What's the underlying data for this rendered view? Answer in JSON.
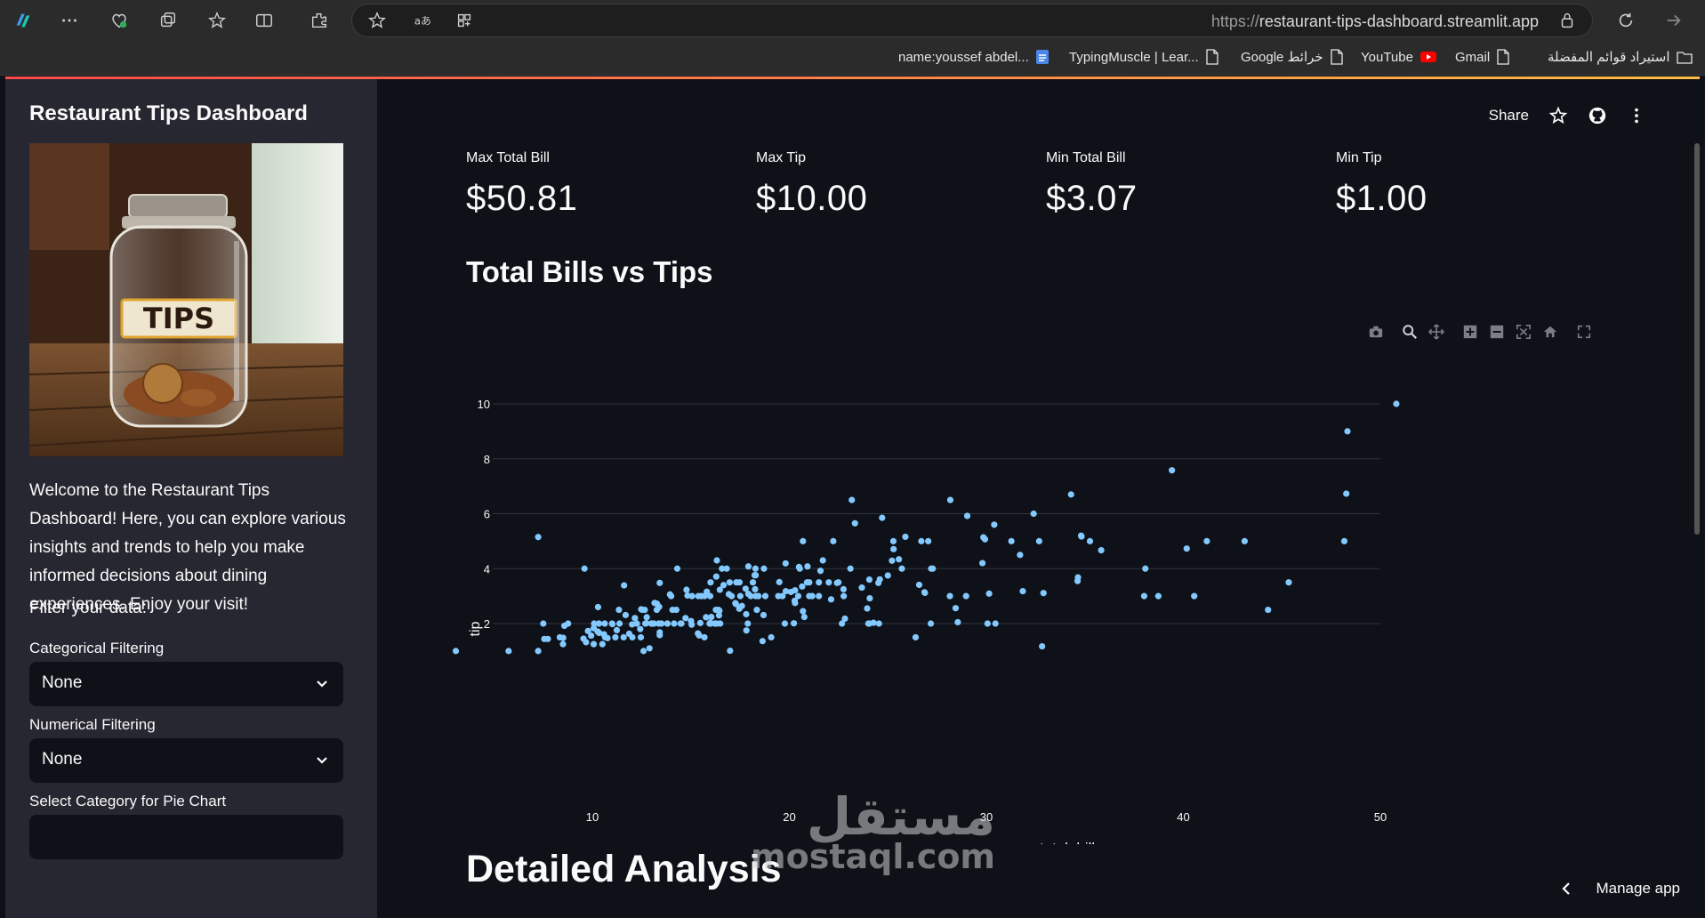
{
  "browser": {
    "url_protocol": "https://",
    "url_host": "restaurant-tips-dashboard.streamlit.app",
    "bookmarks": [
      "name:youssef abdel...",
      "TypingMuscle | Lear...",
      "Google خرائط",
      "YouTube",
      "Gmail",
      "استيراد قوائم المفضلة"
    ]
  },
  "sidebar": {
    "title": "Restaurant Tips Dashboard",
    "jar_label": "TIPS",
    "welcome": "Welcome to the Restaurant Tips Dashboard! Here, you can explore various insights and trends to help you make informed decisions about dining experiences. Enjoy your visit!",
    "filter_heading": "Filter your data:",
    "categorical_label": "Categorical Filtering",
    "categorical_value": "None",
    "numerical_label": "Numerical Filtering",
    "numerical_value": "None",
    "pie_label": "Select Category for Pie Chart"
  },
  "header": {
    "share_label": "Share"
  },
  "metrics": [
    {
      "label": "Max Total Bill",
      "value": "$50.81"
    },
    {
      "label": "Max Tip",
      "value": "$10.00"
    },
    {
      "label": "Min Total Bill",
      "value": "$3.07"
    },
    {
      "label": "Min Tip",
      "value": "$1.00"
    }
  ],
  "section_title": "Total Bills vs Tips",
  "section_title_2": "Detailed Analysis",
  "manage_label": "Manage app",
  "watermark": {
    "arabic": "مستقل",
    "latin": "mostaql.com"
  },
  "colors": {
    "marker": "#83c9ff",
    "grid": "#31333f",
    "accent": "#ff4b4b"
  },
  "chart_data": {
    "type": "scatter",
    "title": "",
    "xlabel": "total_bill",
    "ylabel": "tip",
    "xlim": [
      2.5,
      53.5
    ],
    "ylim": [
      0.7,
      10.4
    ],
    "xticks": [
      10,
      20,
      30,
      40,
      50
    ],
    "yticks": [
      2,
      4,
      6,
      8,
      10
    ],
    "grid": true,
    "points": [
      [
        16.99,
        1.01
      ],
      [
        10.34,
        1.66
      ],
      [
        21.01,
        3.5
      ],
      [
        23.68,
        3.31
      ],
      [
        24.59,
        3.61
      ],
      [
        25.29,
        4.71
      ],
      [
        8.77,
        2.0
      ],
      [
        26.88,
        3.12
      ],
      [
        15.04,
        1.96
      ],
      [
        14.78,
        3.23
      ],
      [
        10.27,
        1.71
      ],
      [
        35.26,
        5.0
      ],
      [
        15.42,
        1.57
      ],
      [
        18.43,
        3.0
      ],
      [
        14.83,
        3.02
      ],
      [
        21.58,
        3.92
      ],
      [
        10.33,
        1.67
      ],
      [
        16.29,
        3.71
      ],
      [
        16.97,
        3.5
      ],
      [
        20.65,
        3.35
      ],
      [
        17.92,
        4.08
      ],
      [
        20.29,
        2.75
      ],
      [
        15.77,
        2.23
      ],
      [
        39.42,
        7.58
      ],
      [
        19.82,
        3.18
      ],
      [
        17.81,
        2.34
      ],
      [
        13.37,
        2.0
      ],
      [
        12.69,
        2.0
      ],
      [
        21.7,
        4.3
      ],
      [
        19.65,
        3.0
      ],
      [
        9.55,
        1.45
      ],
      [
        18.35,
        2.5
      ],
      [
        15.06,
        3.0
      ],
      [
        20.69,
        2.45
      ],
      [
        17.78,
        3.27
      ],
      [
        24.06,
        3.6
      ],
      [
        16.31,
        2.0
      ],
      [
        16.93,
        3.07
      ],
      [
        18.69,
        2.31
      ],
      [
        31.27,
        5.0
      ],
      [
        16.04,
        2.24
      ],
      [
        17.46,
        2.54
      ],
      [
        13.94,
        3.06
      ],
      [
        9.68,
        1.32
      ],
      [
        30.4,
        5.6
      ],
      [
        18.29,
        3.0
      ],
      [
        22.23,
        5.0
      ],
      [
        32.4,
        6.0
      ],
      [
        28.55,
        2.05
      ],
      [
        18.04,
        3.0
      ],
      [
        12.54,
        2.5
      ],
      [
        10.29,
        2.6
      ],
      [
        34.81,
        5.2
      ],
      [
        9.94,
        1.56
      ],
      [
        25.56,
        4.34
      ],
      [
        19.49,
        3.51
      ],
      [
        38.01,
        3.0
      ],
      [
        26.41,
        1.5
      ],
      [
        11.24,
        1.76
      ],
      [
        48.27,
        6.73
      ],
      [
        20.29,
        3.21
      ],
      [
        13.81,
        2.0
      ],
      [
        11.02,
        1.98
      ],
      [
        18.29,
        3.76
      ],
      [
        17.59,
        2.64
      ],
      [
        20.08,
        3.15
      ],
      [
        16.45,
        2.47
      ],
      [
        3.07,
        1.0
      ],
      [
        20.23,
        2.01
      ],
      [
        15.01,
        2.09
      ],
      [
        12.02,
        1.97
      ],
      [
        17.07,
        3.0
      ],
      [
        26.86,
        3.14
      ],
      [
        25.28,
        5.0
      ],
      [
        14.73,
        2.2
      ],
      [
        10.51,
        1.25
      ],
      [
        17.92,
        3.08
      ],
      [
        27.2,
        4.0
      ],
      [
        22.76,
        3.0
      ],
      [
        17.29,
        2.71
      ],
      [
        19.44,
        3.0
      ],
      [
        16.66,
        3.4
      ],
      [
        10.07,
        1.83
      ],
      [
        32.68,
        5.0
      ],
      [
        15.98,
        2.03
      ],
      [
        34.83,
        5.17
      ],
      [
        13.03,
        2.0
      ],
      [
        18.28,
        4.0
      ],
      [
        24.71,
        5.85
      ],
      [
        21.16,
        3.0
      ],
      [
        28.97,
        3.0
      ],
      [
        22.49,
        3.5
      ],
      [
        5.75,
        1.0
      ],
      [
        16.32,
        4.3
      ],
      [
        22.75,
        3.25
      ],
      [
        40.17,
        4.73
      ],
      [
        27.28,
        4.0
      ],
      [
        12.03,
        1.5
      ],
      [
        21.01,
        3.0
      ],
      [
        12.46,
        1.5
      ],
      [
        11.35,
        2.5
      ],
      [
        15.38,
        3.0
      ],
      [
        44.3,
        2.5
      ],
      [
        22.42,
        3.48
      ],
      [
        20.92,
        4.08
      ],
      [
        15.36,
        1.64
      ],
      [
        20.49,
        4.06
      ],
      [
        25.21,
        4.29
      ],
      [
        18.24,
        3.76
      ],
      [
        14.31,
        4.0
      ],
      [
        14.0,
        3.0
      ],
      [
        7.25,
        1.0
      ],
      [
        38.07,
        4.0
      ],
      [
        23.95,
        2.55
      ],
      [
        25.71,
        4.0
      ],
      [
        17.31,
        3.5
      ],
      [
        29.93,
        5.07
      ],
      [
        10.65,
        1.5
      ],
      [
        12.43,
        1.8
      ],
      [
        24.08,
        2.92
      ],
      [
        11.69,
        2.31
      ],
      [
        13.42,
        1.68
      ],
      [
        14.26,
        2.5
      ],
      [
        15.95,
        2.0
      ],
      [
        12.48,
        2.52
      ],
      [
        29.8,
        4.2
      ],
      [
        8.52,
        1.48
      ],
      [
        14.52,
        2.0
      ],
      [
        11.38,
        2.0
      ],
      [
        22.82,
        2.18
      ],
      [
        19.08,
        1.5
      ],
      [
        20.27,
        2.83
      ],
      [
        11.17,
        1.5
      ],
      [
        12.26,
        2.0
      ],
      [
        18.26,
        3.25
      ],
      [
        8.51,
        1.25
      ],
      [
        10.33,
        2.0
      ],
      [
        14.15,
        2.0
      ],
      [
        16.0,
        2.0
      ],
      [
        13.16,
        2.75
      ],
      [
        17.47,
        3.5
      ],
      [
        34.3,
        6.7
      ],
      [
        41.19,
        5.0
      ],
      [
        27.05,
        5.0
      ],
      [
        16.43,
        2.3
      ],
      [
        8.35,
        1.5
      ],
      [
        18.64,
        1.36
      ],
      [
        11.87,
        1.63
      ],
      [
        9.78,
        1.73
      ],
      [
        7.51,
        2.0
      ],
      [
        14.07,
        2.5
      ],
      [
        13.13,
        2.0
      ],
      [
        17.26,
        2.74
      ],
      [
        24.55,
        2.0
      ],
      [
        19.77,
        2.0
      ],
      [
        29.85,
        5.14
      ],
      [
        48.17,
        5.0
      ],
      [
        25.0,
        3.75
      ],
      [
        13.39,
        2.61
      ],
      [
        16.49,
        2.0
      ],
      [
        21.5,
        3.5
      ],
      [
        12.66,
        2.5
      ],
      [
        16.21,
        2.0
      ],
      [
        13.81,
        2.0
      ],
      [
        17.51,
        3.0
      ],
      [
        24.52,
        3.48
      ],
      [
        20.76,
        2.24
      ],
      [
        31.71,
        4.5
      ],
      [
        10.59,
        1.61
      ],
      [
        10.63,
        2.0
      ],
      [
        50.81,
        10.0
      ],
      [
        15.81,
        3.16
      ],
      [
        7.25,
        5.15
      ],
      [
        31.85,
        3.18
      ],
      [
        16.82,
        4.0
      ],
      [
        32.9,
        3.11
      ],
      [
        17.89,
        2.0
      ],
      [
        14.48,
        2.0
      ],
      [
        34.63,
        3.55
      ],
      [
        34.65,
        3.68
      ],
      [
        23.33,
        5.65
      ],
      [
        45.35,
        3.5
      ],
      [
        23.17,
        6.5
      ],
      [
        40.55,
        3.0
      ],
      [
        20.69,
        5.0
      ],
      [
        20.9,
        3.5
      ],
      [
        30.46,
        2.0
      ],
      [
        18.15,
        3.5
      ],
      [
        23.1,
        4.0
      ],
      [
        15.69,
        1.5
      ],
      [
        19.81,
        4.19
      ],
      [
        28.44,
        2.56
      ],
      [
        15.48,
        2.02
      ],
      [
        16.58,
        4.0
      ],
      [
        7.56,
        1.44
      ],
      [
        10.34,
        2.0
      ],
      [
        43.11,
        5.0
      ],
      [
        13.0,
        2.0
      ],
      [
        13.51,
        2.0
      ],
      [
        18.71,
        4.0
      ],
      [
        12.74,
        2.01
      ],
      [
        13.0,
        2.0
      ],
      [
        16.4,
        2.5
      ],
      [
        20.53,
        4.0
      ],
      [
        16.47,
        3.23
      ],
      [
        26.59,
        3.41
      ],
      [
        38.73,
        3.0
      ],
      [
        24.27,
        2.03
      ],
      [
        12.76,
        2.23
      ],
      [
        30.06,
        2.0
      ],
      [
        25.89,
        5.16
      ],
      [
        48.33,
        9.0
      ],
      [
        13.27,
        2.5
      ],
      [
        28.17,
        6.5
      ],
      [
        12.9,
        1.1
      ],
      [
        28.15,
        3.0
      ],
      [
        11.59,
        1.5
      ],
      [
        7.74,
        1.44
      ],
      [
        30.14,
        3.09
      ],
      [
        12.16,
        2.2
      ],
      [
        13.42,
        3.48
      ],
      [
        8.58,
        1.92
      ],
      [
        15.98,
        3.0
      ],
      [
        13.42,
        1.58
      ],
      [
        16.27,
        2.5
      ],
      [
        10.09,
        2.0
      ],
      [
        20.45,
        3.0
      ],
      [
        13.28,
        2.72
      ],
      [
        22.12,
        2.88
      ],
      [
        24.01,
        2.0
      ],
      [
        15.69,
        3.0
      ],
      [
        11.61,
        3.39
      ],
      [
        10.77,
        1.47
      ],
      [
        15.53,
        3.0
      ],
      [
        10.07,
        1.25
      ],
      [
        12.6,
        1.0
      ],
      [
        32.83,
        1.17
      ],
      [
        35.83,
        4.67
      ],
      [
        29.03,
        5.92
      ],
      [
        27.18,
        2.0
      ],
      [
        22.67,
        2.0
      ],
      [
        17.82,
        1.75
      ],
      [
        18.78,
        3.0
      ],
      [
        9.6,
        4.0
      ],
      [
        21.5,
        3.0
      ],
      [
        24.06,
        2.0
      ],
      [
        22.0,
        3.5
      ],
      [
        26.7,
        5.0
      ],
      [
        16.0,
        3.5
      ],
      [
        11.0,
        2.0
      ]
    ]
  }
}
